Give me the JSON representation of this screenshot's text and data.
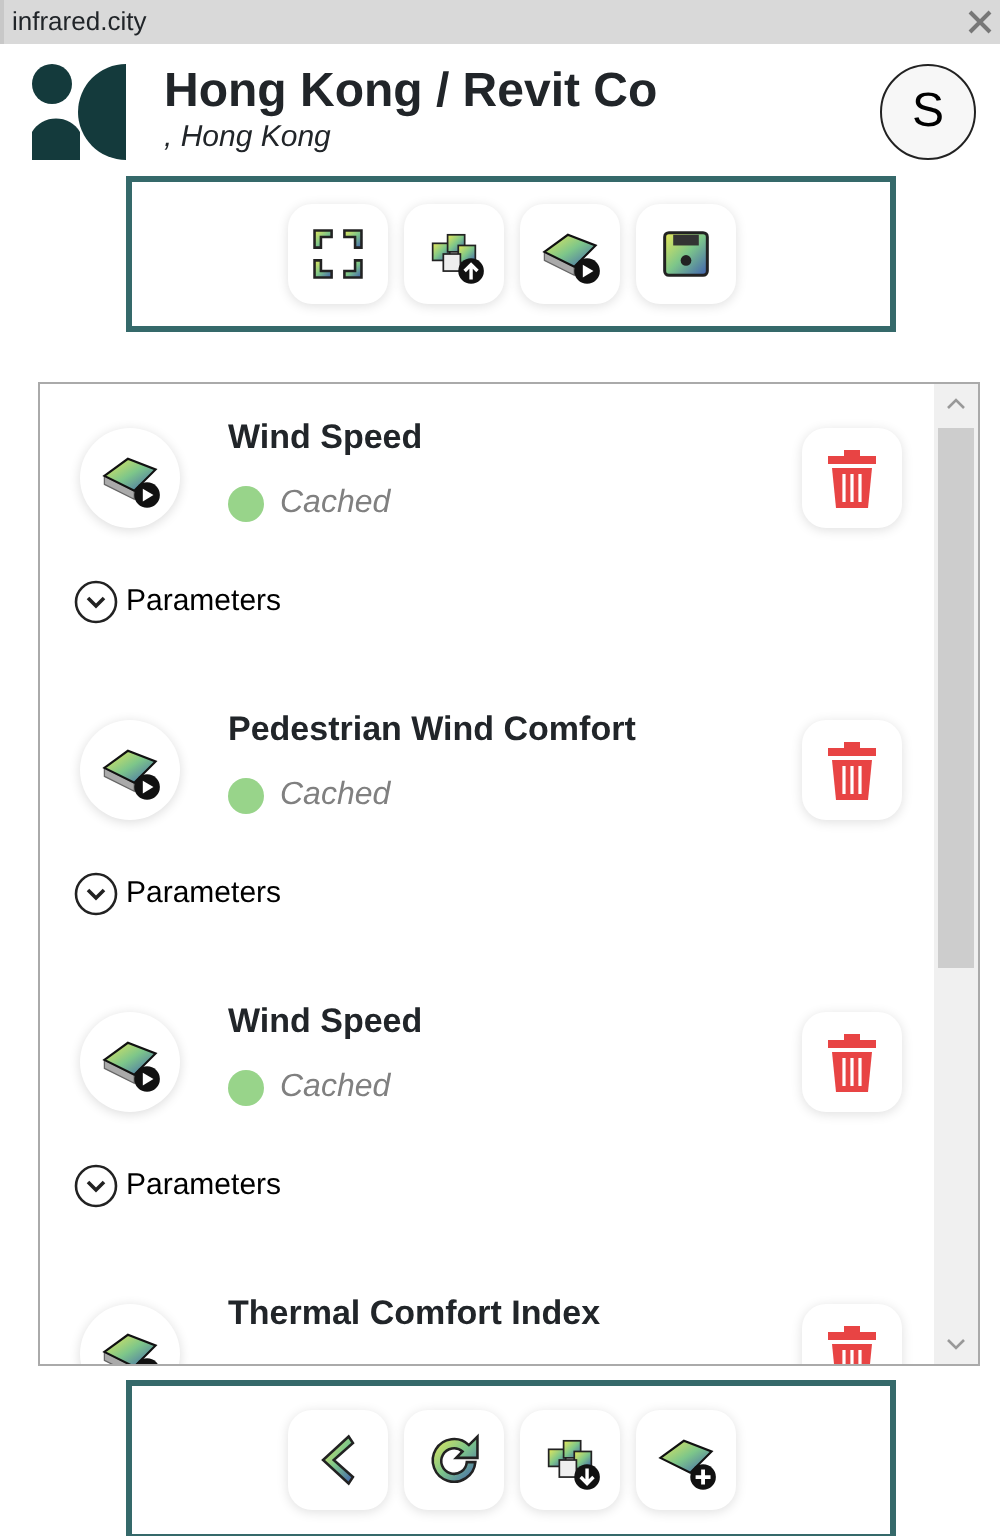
{
  "window": {
    "title": "infrared.city"
  },
  "header": {
    "title": "Hong Kong / Revit Co",
    "subtitle": ", Hong Kong",
    "avatar": "S"
  },
  "top_toolbar": [
    {
      "kind": "fit"
    },
    {
      "kind": "upload"
    },
    {
      "kind": "run-layers"
    },
    {
      "kind": "save"
    }
  ],
  "analyses": [
    {
      "name": "Wind Speed",
      "status": "Cached",
      "color": "#98d48a",
      "parameters": "Parameters",
      "expanded": false
    },
    {
      "name": "Pedestrian Wind Comfort",
      "status": "Cached",
      "color": "#98d48a",
      "parameters": "Parameters",
      "expanded": false
    },
    {
      "name": "Wind Speed",
      "status": "Cached",
      "color": "#98d48a",
      "parameters": "Parameters",
      "expanded": false
    },
    {
      "name": "Thermal Comfort Index"
    }
  ],
  "bottom_toolbar": [
    {
      "kind": "back"
    },
    {
      "kind": "refresh"
    },
    {
      "kind": "download"
    },
    {
      "kind": "add-layer"
    }
  ]
}
